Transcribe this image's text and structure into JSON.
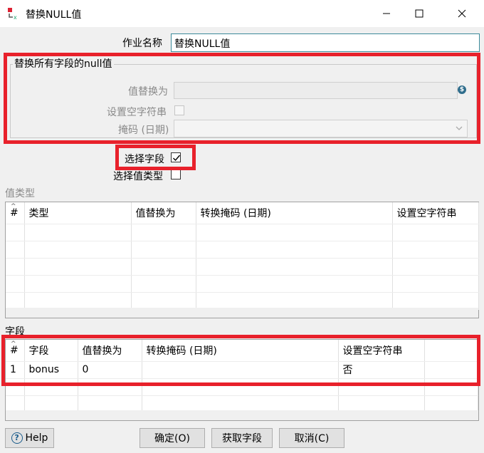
{
  "window": {
    "title": "替换NULL值",
    "minimize_glyph": "—",
    "maximize_glyph": "☐",
    "close_glyph": "✕"
  },
  "job": {
    "label": "作业名称",
    "value": "替换NULL值"
  },
  "all_fields_group": {
    "title": "替换所有字段的null值",
    "replace_label": "值替换为",
    "replace_value": "",
    "variable_icon": "$",
    "empty_string_label": "设置空字符串",
    "empty_string_checked": false,
    "mask_label": "掩码 (日期)",
    "mask_value": ""
  },
  "select_fields": {
    "label": "选择字段",
    "checked": true
  },
  "select_value_types": {
    "label": "选择值类型",
    "checked": false
  },
  "value_types_grid": {
    "section_label": "值类型",
    "columns": [
      "#",
      "类型",
      "值替换为",
      "转换掩码 (日期)",
      "设置空字符串"
    ],
    "rows": []
  },
  "fields_grid": {
    "section_label": "字段",
    "columns": [
      "#",
      "字段",
      "值替换为",
      "转换掩码 (日期)",
      "设置空字符串"
    ],
    "rows": [
      [
        "1",
        "bonus",
        "0",
        "",
        "否"
      ]
    ]
  },
  "buttons": {
    "help": "Help",
    "ok": "确定(O)",
    "get_fields": "获取字段",
    "cancel": "取消(C)"
  },
  "colors": {
    "highlight": "#e8212b",
    "background": "#f0f0f0"
  },
  "icons": {
    "app": "replace-null-icon",
    "help": "help-circle-icon",
    "variable": "variable-dollar-icon",
    "dropdown": "chevron-down-icon"
  }
}
